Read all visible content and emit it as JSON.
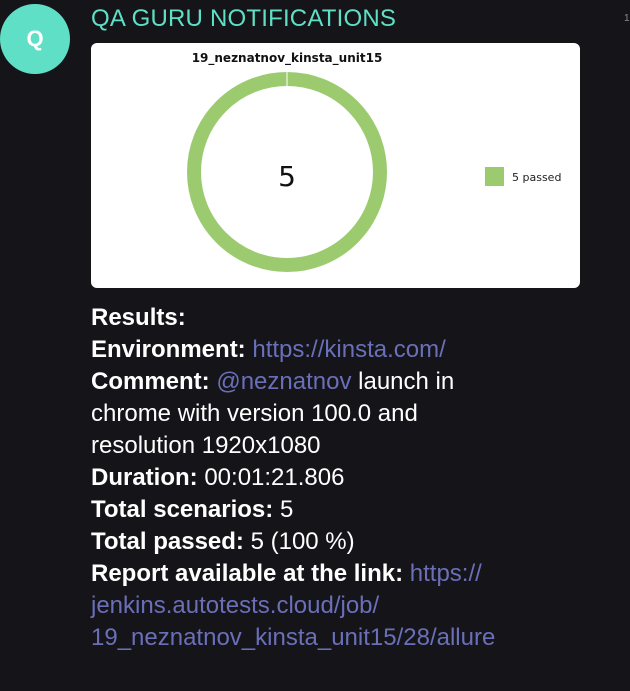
{
  "avatar": {
    "letter": "Q",
    "bg_color": "#5fe0c6"
  },
  "corner_mark": "1",
  "channel": {
    "name": "QA GURU NOTIFICATIONS",
    "color": "#5fe0c6"
  },
  "chart_data": {
    "type": "pie",
    "title": "19_neznatnov_kinsta_unit15",
    "center_label": "5",
    "slices": [
      {
        "label": "passed",
        "value": 5,
        "color": "#9ccb6f"
      }
    ],
    "legend": {
      "placement": "right",
      "entries": [
        {
          "text": "5 passed",
          "color": "#9ccb6f"
        }
      ]
    }
  },
  "message": {
    "results_label": "Results:",
    "environment_label": "Environment:",
    "environment_value": "https://kinsta.com/",
    "comment_label": "Comment:",
    "comment_mention": "@neznatnov",
    "comment_text_1": " launch in",
    "comment_text_2": "chrome with version 100.0 and",
    "comment_text_3": "resolution 1920x1080",
    "duration_label": "Duration:",
    "duration_value": " 00:01:21.806",
    "total_scenarios_label": "Total scenarios:",
    "total_scenarios_value": " 5",
    "total_passed_label": "Total passed:",
    "total_passed_value": " 5 (100 %)",
    "report_label": "Report available at the link:",
    "report_link_1": "https://",
    "report_link_2": "jenkins.autotests.cloud/job/",
    "report_link_3": "19_neznatnov_kinsta_unit15/28/allure",
    "link_color": "#6a6fb8"
  }
}
